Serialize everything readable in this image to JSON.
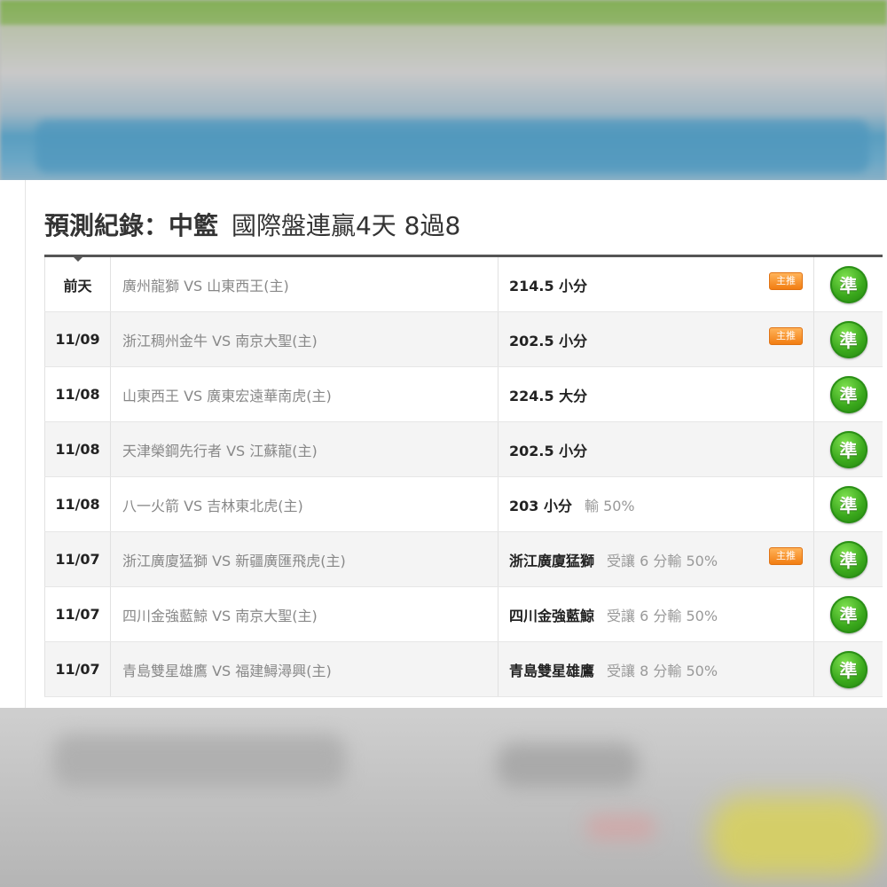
{
  "title": {
    "label": "預測紀錄：",
    "league": "中籃",
    "streak": "國際盤連贏4天 8過8"
  },
  "colors": {
    "hit_green": "#3aa81c",
    "badge_orange": "#f27d12",
    "header_rule": "#555555"
  },
  "rows": [
    {
      "date": "前天",
      "match": "廣州龍獅 VS 山東西王(主)",
      "pick": "214.5 小分",
      "extra": "",
      "badge": "主推",
      "result": "準"
    },
    {
      "date": "11/09",
      "match": "浙江稠州金牛 VS 南京大聖(主)",
      "pick": "202.5 小分",
      "extra": "",
      "badge": "主推",
      "result": "準"
    },
    {
      "date": "11/08",
      "match": "山東西王 VS 廣東宏遠華南虎(主)",
      "pick": "224.5 大分",
      "extra": "",
      "badge": "",
      "result": "準"
    },
    {
      "date": "11/08",
      "match": "天津榮鋼先行者 VS 江蘇龍(主)",
      "pick": "202.5 小分",
      "extra": "",
      "badge": "",
      "result": "準"
    },
    {
      "date": "11/08",
      "match": "八一火箭 VS 吉林東北虎(主)",
      "pick": "203 小分",
      "extra": "輸 50%",
      "badge": "",
      "result": "準"
    },
    {
      "date": "11/07",
      "match": "浙江廣廈猛獅 VS 新疆廣匯飛虎(主)",
      "pick": "浙江廣廈猛獅",
      "extra": "受讓 6 分輸 50%",
      "badge": "主推",
      "result": "準"
    },
    {
      "date": "11/07",
      "match": "四川金強藍鯨 VS 南京大聖(主)",
      "pick": "四川金強藍鯨",
      "extra": "受讓 6 分輸 50%",
      "badge": "",
      "result": "準"
    },
    {
      "date": "11/07",
      "match": "青島雙星雄鷹 VS 福建鱘潯興(主)",
      "pick": "青島雙星雄鷹",
      "extra": "受讓 8 分輸 50%",
      "badge": "",
      "result": "準"
    }
  ]
}
